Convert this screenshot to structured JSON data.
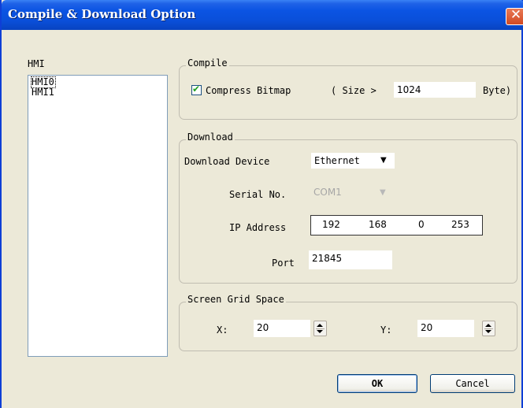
{
  "window": {
    "title": "Compile & Download Option",
    "close_glyph": "✕"
  },
  "hmi_panel": {
    "label": "HMI",
    "items": [
      "HMI0",
      "HMI1"
    ]
  },
  "compile": {
    "legend": "Compile",
    "compress_bitmap_label": "Compress Bitmap",
    "compress_bitmap_checked": true,
    "size_prefix": "( Size >",
    "size_value": "1024",
    "size_suffix": "Byte)"
  },
  "download": {
    "legend": "Download",
    "device_label": "Download Device",
    "device_value": "Ethernet",
    "serial_label": "Serial No.",
    "serial_value": "COM1",
    "ip_label": "IP Address",
    "ip": [
      "192",
      "168",
      "0",
      "253"
    ],
    "port_label": "Port",
    "port_value": "21845"
  },
  "grid": {
    "legend": "Screen Grid Space",
    "x_label": "X:",
    "x_value": "20",
    "y_label": "Y:",
    "y_value": "20"
  },
  "buttons": {
    "ok": "OK",
    "cancel": "Cancel"
  }
}
